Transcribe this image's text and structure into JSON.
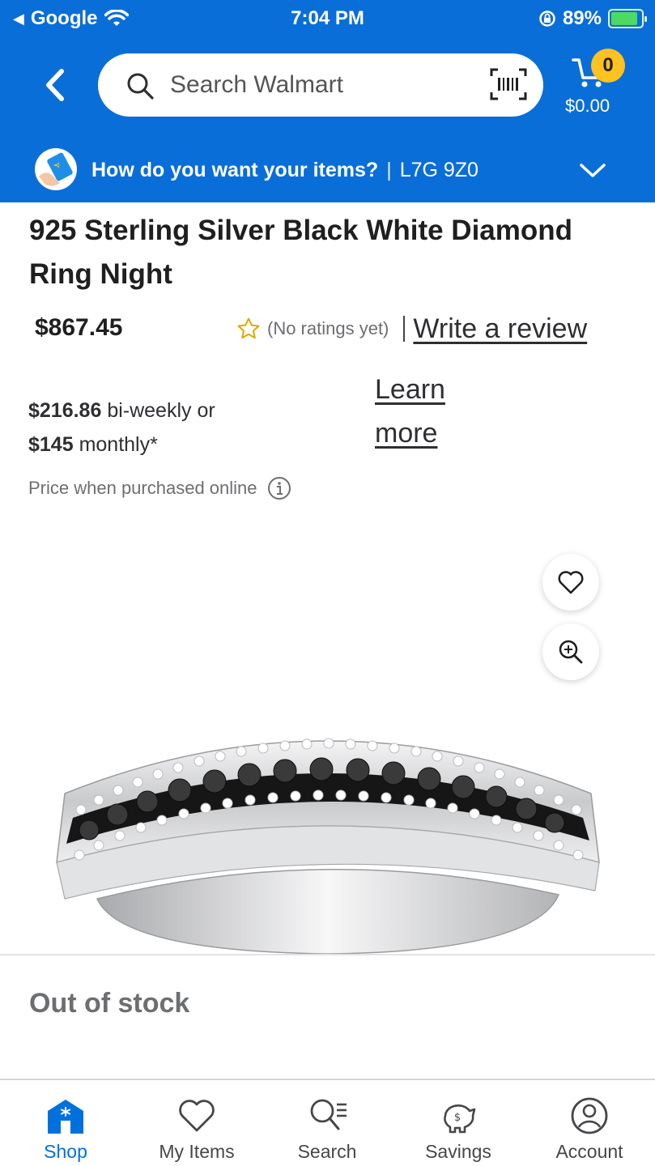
{
  "status_bar": {
    "carrier": "Google",
    "time": "7:04 PM",
    "battery": "89%",
    "battery_level": 0.89
  },
  "header": {
    "search_placeholder": "Search Walmart",
    "cart_count": "0",
    "cart_total": "$0.00",
    "fulfillment_question": "How do you want your items?",
    "fulfillment_separator": "|",
    "postal_code": "L7G 9Z0"
  },
  "product": {
    "title": "925 Sterling Silver Black White Diamond Ring Night",
    "price": "$867.45",
    "rating_text": "(No ratings yet)",
    "write_review": "Write a review",
    "installment_biweekly_amount": "$216.86",
    "installment_biweekly_text": " bi-weekly or",
    "installment_monthly_amount": "$145",
    "installment_monthly_text": " monthly*",
    "learn_more": "Learn more",
    "price_note": "Price when purchased online",
    "availability": "Out of stock"
  },
  "tabs": [
    {
      "label": "Shop",
      "icon": "shop-icon",
      "active": true
    },
    {
      "label": "My Items",
      "icon": "heart-icon",
      "active": false
    },
    {
      "label": "Search",
      "icon": "search-list-icon",
      "active": false
    },
    {
      "label": "Savings",
      "icon": "piggy-bank-icon",
      "active": false
    },
    {
      "label": "Account",
      "icon": "account-icon",
      "active": false
    }
  ],
  "colors": {
    "header_blue": "#0a6ed8",
    "badge_yellow": "#ffc220",
    "active_tab": "#0071dc"
  }
}
